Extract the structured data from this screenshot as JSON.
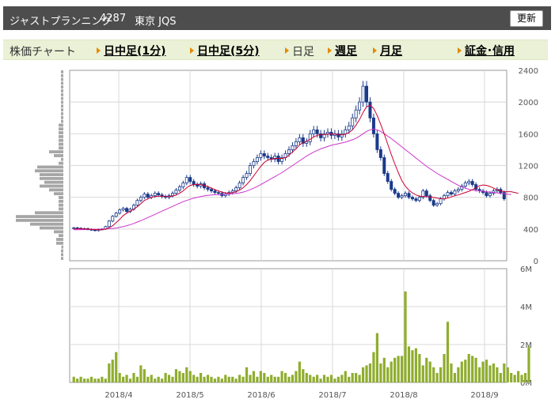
{
  "header": {
    "name": "ジャストプランニング",
    "code": "4287",
    "market": "東京 JQS",
    "refresh_label": "更新"
  },
  "tabs": {
    "chart_label": "株価チャート",
    "intraday1": "日中足(1分)",
    "intraday5": "日中足(5分)",
    "daily": "日足",
    "weekly": "週足",
    "monthly": "月足",
    "margin": "証金･信用"
  },
  "colors": {
    "up": "#ffffff",
    "down": "#1a3a8a",
    "candle_stroke": "#1a3a8a",
    "ma_short": "#cc0033",
    "ma_long": "#cc33cc",
    "volume": "#8fad2e",
    "grid": "#d8d8d8",
    "profile": "#a6a6a6"
  },
  "chart_data": [
    {
      "type": "candlestick",
      "ylim": [
        0,
        2400
      ],
      "yticks": [
        0,
        400,
        800,
        1200,
        1600,
        2000,
        2400
      ],
      "xticks": [
        "2018/4",
        "2018/5",
        "2018/6",
        "2018/7",
        "2018/8",
        "2018/9"
      ],
      "close": [
        415,
        410,
        400,
        405,
        395,
        390,
        380,
        395,
        400,
        430,
        500,
        560,
        600,
        640,
        660,
        620,
        650,
        700,
        760,
        800,
        840,
        800,
        820,
        850,
        830,
        810,
        800,
        820,
        850,
        890,
        930,
        980,
        1050,
        1000,
        960,
        940,
        970,
        920,
        900,
        880,
        860,
        850,
        820,
        840,
        860,
        880,
        920,
        980,
        1050,
        1100,
        1200,
        1250,
        1300,
        1350,
        1320,
        1300,
        1280,
        1320,
        1250,
        1300,
        1350,
        1400,
        1450,
        1500,
        1550,
        1480,
        1500,
        1600,
        1650,
        1600,
        1550,
        1600,
        1620,
        1580,
        1600,
        1560,
        1600,
        1650,
        1700,
        1800,
        1900,
        2000,
        2200,
        2000,
        1800,
        1600,
        1400,
        1300,
        1100,
        1000,
        900,
        850,
        800,
        820,
        850,
        800,
        780,
        760,
        800,
        880,
        820,
        760,
        700,
        720,
        780,
        820,
        860,
        840,
        880,
        900,
        940,
        980,
        1000,
        960,
        900,
        880,
        860,
        820,
        850,
        880,
        900,
        860,
        780
      ],
      "ma_short": [
        400,
        402,
        405,
        400,
        398,
        395,
        392,
        390,
        392,
        398,
        415,
        440,
        480,
        520,
        570,
        600,
        625,
        650,
        680,
        720,
        760,
        780,
        800,
        810,
        815,
        815,
        812,
        810,
        815,
        828,
        850,
        880,
        920,
        950,
        960,
        965,
        960,
        950,
        935,
        915,
        895,
        880,
        865,
        855,
        852,
        858,
        870,
        890,
        920,
        960,
        1010,
        1070,
        1130,
        1190,
        1240,
        1270,
        1280,
        1290,
        1290,
        1290,
        1300,
        1330,
        1370,
        1410,
        1460,
        1490,
        1510,
        1530,
        1560,
        1580,
        1590,
        1590,
        1595,
        1600,
        1595,
        1590,
        1585,
        1595,
        1615,
        1650,
        1710,
        1780,
        1870,
        1940,
        1960,
        1920,
        1830,
        1720,
        1600,
        1470,
        1340,
        1220,
        1110,
        1010,
        940,
        890,
        855,
        830,
        815,
        810,
        810,
        805,
        800,
        790,
        785,
        780,
        790,
        805,
        820,
        830,
        845,
        860,
        875,
        895,
        920,
        945,
        955,
        950,
        935,
        915,
        895,
        880,
        870,
        870,
        870,
        860,
        850
      ],
      "ma_long": [
        390,
        391,
        392,
        393,
        394,
        395,
        396,
        397,
        398,
        400,
        402,
        406,
        412,
        420,
        430,
        442,
        455,
        470,
        488,
        506,
        525,
        545,
        565,
        585,
        605,
        625,
        645,
        665,
        685,
        705,
        725,
        745,
        760,
        775,
        790,
        800,
        810,
        818,
        825,
        830,
        833,
        835,
        836,
        838,
        840,
        843,
        848,
        855,
        865,
        878,
        895,
        915,
        935,
        960,
        985,
        1010,
        1035,
        1060,
        1085,
        1110,
        1140,
        1170,
        1200,
        1230,
        1260,
        1290,
        1320,
        1345,
        1370,
        1390,
        1410,
        1425,
        1440,
        1455,
        1465,
        1475,
        1485,
        1495,
        1510,
        1525,
        1545,
        1570,
        1600,
        1630,
        1650,
        1660,
        1650,
        1630,
        1600,
        1570,
        1540,
        1505,
        1470,
        1435,
        1400,
        1365,
        1330,
        1295,
        1260,
        1225,
        1190,
        1160,
        1130,
        1100,
        1075,
        1050,
        1025,
        1000,
        975,
        950,
        930,
        915,
        900,
        890,
        885,
        880,
        875,
        870,
        865,
        860,
        855,
        850,
        845,
        840,
        835
      ],
      "volume_M": [
        0.3,
        0.2,
        0.3,
        0.2,
        0.2,
        0.3,
        0.2,
        0.2,
        0.3,
        0.2,
        1.0,
        1.2,
        1.6,
        0.5,
        0.3,
        0.4,
        0.2,
        0.5,
        0.3,
        0.9,
        0.7,
        0.3,
        0.4,
        0.2,
        0.3,
        0.2,
        0.5,
        0.4,
        0.3,
        0.7,
        0.6,
        0.5,
        0.8,
        0.6,
        0.4,
        0.3,
        0.5,
        0.3,
        0.4,
        0.3,
        0.2,
        0.3,
        0.2,
        0.4,
        0.3,
        0.3,
        0.2,
        0.4,
        0.3,
        0.8,
        0.4,
        0.6,
        0.3,
        0.6,
        0.5,
        0.3,
        0.4,
        0.3,
        0.3,
        0.6,
        0.5,
        0.3,
        0.4,
        0.6,
        1.1,
        0.7,
        0.5,
        0.4,
        0.3,
        0.4,
        0.2,
        0.4,
        0.3,
        0.4,
        0.2,
        0.3,
        0.4,
        0.6,
        0.3,
        0.5,
        0.5,
        0.4,
        0.8,
        0.9,
        1.0,
        1.6,
        2.6,
        1.0,
        1.3,
        0.8,
        1.1,
        1.3,
        1.4,
        1.4,
        4.8,
        1.9,
        1.7,
        1.8,
        1.5,
        0.9,
        1.3,
        1.1,
        0.8,
        0.5,
        0.8,
        1.5,
        3.2,
        1.0,
        0.5,
        0.8,
        1.1,
        1.2,
        1.5,
        1.4,
        1.3,
        0.8,
        1.1,
        1.2,
        0.9,
        1.0,
        0.8,
        0.5,
        1.0,
        0.8,
        0.5,
        0.4,
        0.6,
        0.4,
        0.5,
        1.9
      ],
      "volume_ylim": [
        0,
        6
      ],
      "volume_ticks": [
        "0M",
        "2M",
        "4M",
        "6M"
      ],
      "price_profile": [
        0.05,
        0.05,
        0.05,
        0.04,
        0.15,
        0.15,
        0.1,
        0.2,
        0.5,
        0.7,
        1.0,
        1.0,
        0.6,
        0.1,
        0.1,
        0.1,
        0.1,
        0.2,
        0.3,
        0.5,
        0.4,
        0.5,
        0.5,
        0.6,
        0.55,
        0.1,
        0.05,
        0.2,
        0.3,
        0.1,
        0.1,
        0.1,
        0.1,
        0.1,
        0.1,
        0.1,
        0.05,
        0.05,
        0.05,
        0.05,
        0.05,
        0.05,
        0.05,
        0.05,
        0.05,
        0.05,
        0.05,
        0.05,
        0.05,
        0.05
      ]
    }
  ]
}
